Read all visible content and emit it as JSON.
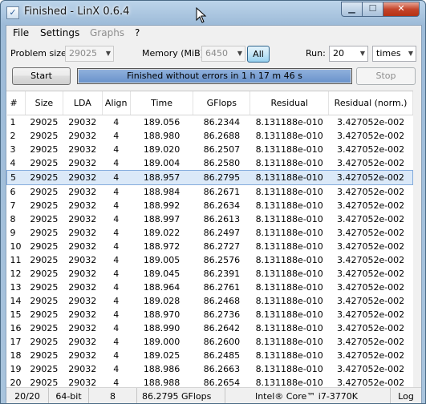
{
  "window": {
    "title": "Finished - LinX 0.6.4"
  },
  "menu": {
    "file": "File",
    "settings": "Settings",
    "graphs": "Graphs",
    "help": "?"
  },
  "controls": {
    "problem_size_label": "Problem size:",
    "problem_size_value": "29025",
    "memory_label": "Memory (MiB):",
    "memory_value": "6450",
    "all_label": "All",
    "run_label": "Run:",
    "run_value": "20",
    "run_unit": "times",
    "start_label": "Start",
    "stop_label": "Stop",
    "status_text": "Finished without errors in 1 h 17 m 46 s",
    "progress_fraction": 1.0
  },
  "table": {
    "columns": [
      "#",
      "Size",
      "LDA",
      "Align",
      "Time",
      "GFlops",
      "Residual",
      "Residual (norm.)"
    ],
    "selected_row": 5,
    "rows": [
      [
        "1",
        "29025",
        "29032",
        "4",
        "189.056",
        "86.2344",
        "8.131188e-010",
        "3.427052e-002"
      ],
      [
        "2",
        "29025",
        "29032",
        "4",
        "188.980",
        "86.2688",
        "8.131188e-010",
        "3.427052e-002"
      ],
      [
        "3",
        "29025",
        "29032",
        "4",
        "189.020",
        "86.2507",
        "8.131188e-010",
        "3.427052e-002"
      ],
      [
        "4",
        "29025",
        "29032",
        "4",
        "189.004",
        "86.2580",
        "8.131188e-010",
        "3.427052e-002"
      ],
      [
        "5",
        "29025",
        "29032",
        "4",
        "188.957",
        "86.2795",
        "8.131188e-010",
        "3.427052e-002"
      ],
      [
        "6",
        "29025",
        "29032",
        "4",
        "188.984",
        "86.2671",
        "8.131188e-010",
        "3.427052e-002"
      ],
      [
        "7",
        "29025",
        "29032",
        "4",
        "188.992",
        "86.2634",
        "8.131188e-010",
        "3.427052e-002"
      ],
      [
        "8",
        "29025",
        "29032",
        "4",
        "188.997",
        "86.2613",
        "8.131188e-010",
        "3.427052e-002"
      ],
      [
        "9",
        "29025",
        "29032",
        "4",
        "189.022",
        "86.2497",
        "8.131188e-010",
        "3.427052e-002"
      ],
      [
        "10",
        "29025",
        "29032",
        "4",
        "188.972",
        "86.2727",
        "8.131188e-010",
        "3.427052e-002"
      ],
      [
        "11",
        "29025",
        "29032",
        "4",
        "189.005",
        "86.2576",
        "8.131188e-010",
        "3.427052e-002"
      ],
      [
        "12",
        "29025",
        "29032",
        "4",
        "189.045",
        "86.2391",
        "8.131188e-010",
        "3.427052e-002"
      ],
      [
        "13",
        "29025",
        "29032",
        "4",
        "188.964",
        "86.2761",
        "8.131188e-010",
        "3.427052e-002"
      ],
      [
        "14",
        "29025",
        "29032",
        "4",
        "189.028",
        "86.2468",
        "8.131188e-010",
        "3.427052e-002"
      ],
      [
        "15",
        "29025",
        "29032",
        "4",
        "188.970",
        "86.2736",
        "8.131188e-010",
        "3.427052e-002"
      ],
      [
        "16",
        "29025",
        "29032",
        "4",
        "188.990",
        "86.2642",
        "8.131188e-010",
        "3.427052e-002"
      ],
      [
        "17",
        "29025",
        "29032",
        "4",
        "189.000",
        "86.2600",
        "8.131188e-010",
        "3.427052e-002"
      ],
      [
        "18",
        "29025",
        "29032",
        "4",
        "189.025",
        "86.2485",
        "8.131188e-010",
        "3.427052e-002"
      ],
      [
        "19",
        "29025",
        "29032",
        "4",
        "188.986",
        "86.2663",
        "8.131188e-010",
        "3.427052e-002"
      ],
      [
        "20",
        "29025",
        "29032",
        "4",
        "188.988",
        "86.2654",
        "8.131188e-010",
        "3.427052e-002"
      ]
    ]
  },
  "status": {
    "runs": "20/20",
    "arch": "64-bit",
    "threads": "8 threads",
    "peak": "86.2795 GFlops peak",
    "cpu": "Intel® Core™ i7-3770K",
    "log": "Log ›"
  },
  "colors": {
    "progress": "#6a93cc",
    "close_button": "#c4452b",
    "selection": "#dbe9f8"
  },
  "icons": [
    "app-icon",
    "minimize-icon",
    "maximize-icon",
    "close-icon",
    "chevron-down-icon",
    "mouse-cursor-icon"
  ]
}
